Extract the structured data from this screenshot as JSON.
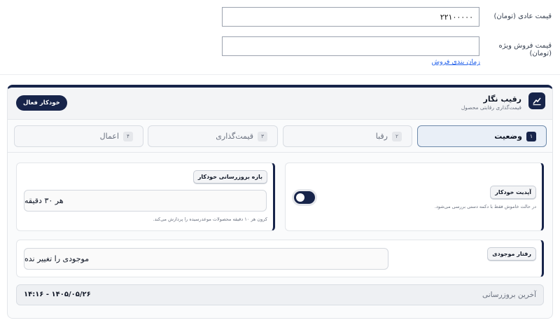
{
  "pricing": {
    "regular_price_label": "قیمت عادی (تومان)",
    "regular_price_value": "۲۲۱۰۰۰۰۰",
    "sale_price_label": "قیمت فروش ویژه (تومان)",
    "sale_price_value": "",
    "schedule_link": "زمان بندی فروش"
  },
  "panel": {
    "title": "رقیب نگار",
    "subtitle": "قیمت‌گذاری رقابتی محصول",
    "auto_button": "خودکار فعال",
    "tabs": [
      {
        "num": "۱",
        "label": "وضعیت",
        "active": true
      },
      {
        "num": "۲",
        "label": "رقبا"
      },
      {
        "num": "۳",
        "label": "قیمت‌گذاری"
      },
      {
        "num": "۴",
        "label": "اعمال"
      }
    ],
    "auto_update": {
      "title": "آپدیت خودکار",
      "note": "در حالت خاموش فقط با دکمه دستی بررسی می‌شود.",
      "enabled": true
    },
    "interval": {
      "title": "بازه بروزرسانی خودکار",
      "value": "هر ۳۰ دقیقه",
      "note": "کرون هر ۱۰ دقیقه محصولات موعدرسیده را پردازش می‌کند."
    },
    "stock": {
      "title": "رفتار موجودی",
      "value": "موجودی را تغییر نده"
    },
    "last_update": {
      "label": "آخرین بروزرسانی",
      "value": "۱۴۰۵/۰۵/۲۶ - ۱۴:۱۶"
    }
  },
  "colors": {
    "accent": "#17244a",
    "link": "#2563eb"
  }
}
